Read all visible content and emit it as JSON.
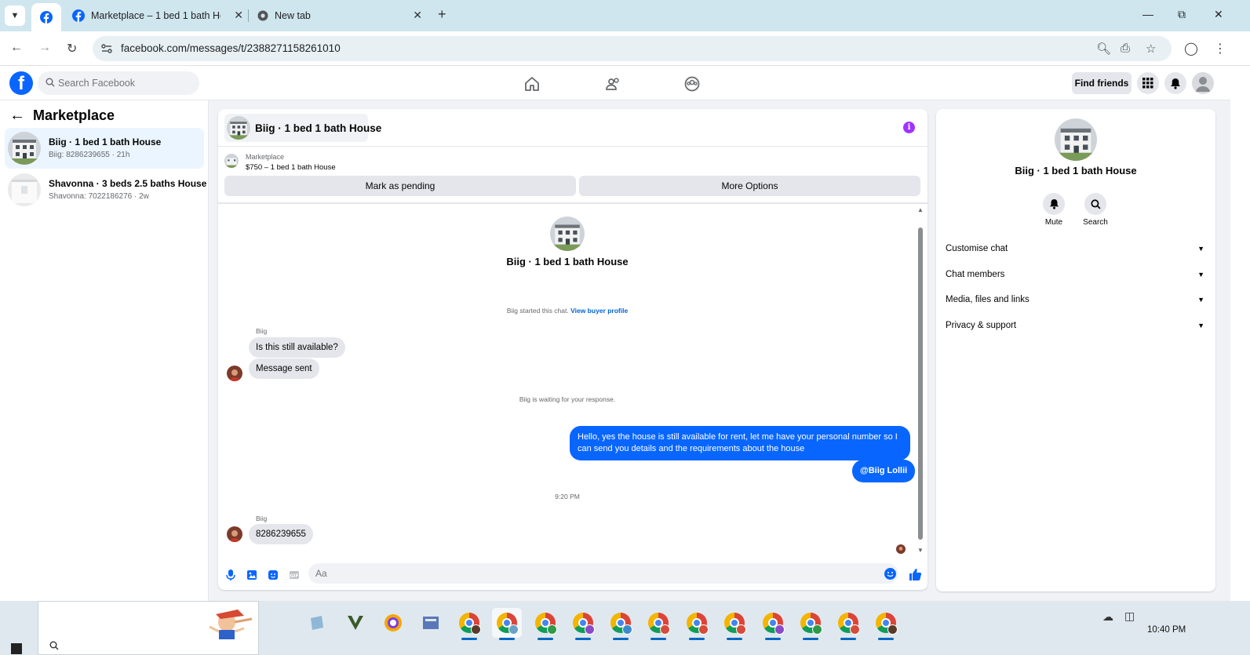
{
  "browser": {
    "tabs": [
      {
        "title": "Marketplace – 1 bed 1 bath Ho"
      },
      {
        "title": "New tab"
      }
    ],
    "url": "facebook.com/messages/t/2388271158261010"
  },
  "fb_header": {
    "search_placeholder": "Search Facebook",
    "find_friends": "Find friends"
  },
  "sidebar": {
    "title": "Marketplace",
    "threads": [
      {
        "title": "Biig · 1 bed 1 bath House",
        "subtitle": "Biig: 8286239655 · 21h",
        "active": true
      },
      {
        "title": "Shavonna · 3 beds 2.5 baths House",
        "subtitle": "Shavonna: 7022186276 · 2w",
        "active": false
      }
    ]
  },
  "conversation": {
    "header_title": "Biig · 1 bed 1 bath House",
    "marketplace_label": "Marketplace",
    "listing": "$750 – 1 bed 1 bath House",
    "mark_pending": "Mark as pending",
    "more_options": "More Options",
    "intro_name": "Biig · 1 bed 1 bath House",
    "started_text": "Biig started this chat.",
    "view_profile": "View buyer profile",
    "sender1": "Biig",
    "msg1": "Is this still available?",
    "msg2": "Message sent",
    "waiting": "Biig is waiting for your response.",
    "out1": "Hello, yes the house is still available for rent, let me have your personal number so I can send you details and the requirements about the house",
    "out2": "@Biig Lollii",
    "time": "9:20 PM",
    "sender2": "Biig",
    "msg3": "8286239655",
    "composer_placeholder": "Aa"
  },
  "details": {
    "name": "Biig · 1 bed 1 bath House",
    "actions": [
      {
        "label": "Mute"
      },
      {
        "label": "Search"
      }
    ],
    "sections": [
      {
        "label": "Customise chat"
      },
      {
        "label": "Chat members"
      },
      {
        "label": "Media, files and links"
      },
      {
        "label": "Privacy & support"
      }
    ]
  },
  "taskbar": {
    "clock": "10:40 PM"
  },
  "colors": {
    "fb_blue": "#0866ff",
    "active_thread": "#ebf5ff",
    "info_purple": "#a033ff"
  }
}
